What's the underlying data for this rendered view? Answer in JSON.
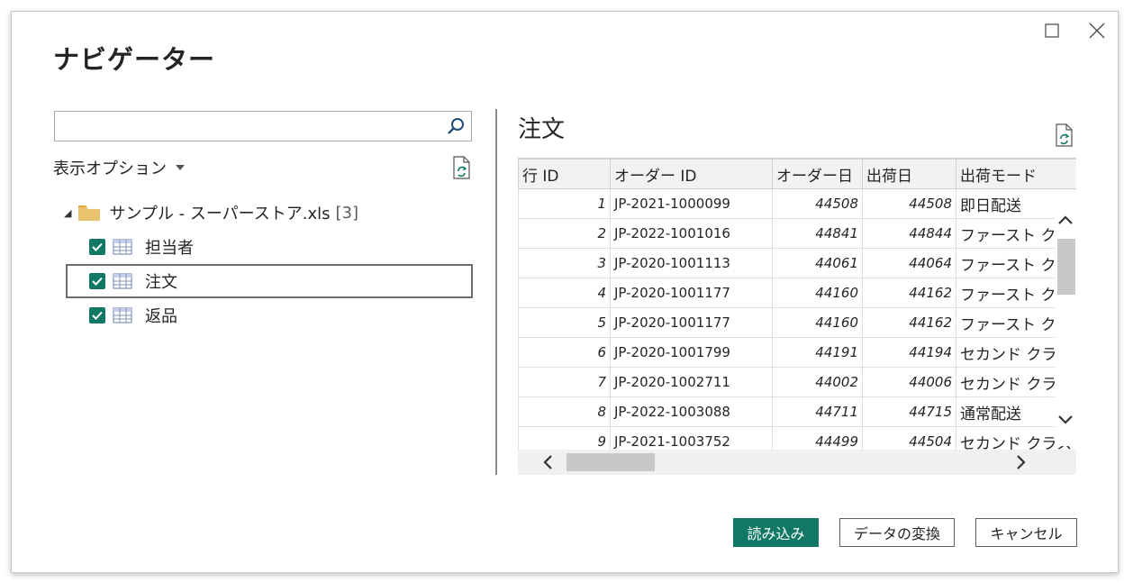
{
  "window": {
    "title": "ナビゲーター"
  },
  "search": {
    "placeholder": "",
    "value": ""
  },
  "view_options": {
    "label": "表示オプション"
  },
  "tree": {
    "file": {
      "name": "サンプル - スーパーストア.xls",
      "count": "[3]"
    },
    "items": [
      {
        "label": "担当者",
        "checked": true,
        "selected": false
      },
      {
        "label": "注文",
        "checked": true,
        "selected": true
      },
      {
        "label": "返品",
        "checked": true,
        "selected": false
      }
    ]
  },
  "preview": {
    "title": "注文",
    "columns": [
      "行 ID",
      "オーダー ID",
      "オーダー日",
      "出荷日",
      "出荷モード"
    ],
    "rows": [
      [
        "1",
        "JP-2021-1000099",
        "44508",
        "44508",
        "即日配送"
      ],
      [
        "2",
        "JP-2022-1001016",
        "44841",
        "44844",
        "ファースト クラ"
      ],
      [
        "3",
        "JP-2020-1001113",
        "44061",
        "44064",
        "ファースト クラ"
      ],
      [
        "4",
        "JP-2020-1001177",
        "44160",
        "44162",
        "ファースト クラ"
      ],
      [
        "5",
        "JP-2020-1001177",
        "44160",
        "44162",
        "ファースト クラ"
      ],
      [
        "6",
        "JP-2020-1001799",
        "44191",
        "44194",
        "セカンド クラス"
      ],
      [
        "7",
        "JP-2020-1002711",
        "44002",
        "44006",
        "セカンド クラス"
      ],
      [
        "8",
        "JP-2022-1003088",
        "44711",
        "44715",
        "通常配送"
      ],
      [
        "9",
        "JP-2021-1003752",
        "44499",
        "44504",
        "セカンド クラス"
      ]
    ]
  },
  "buttons": {
    "load": "読み込み",
    "transform": "データの変換",
    "cancel": "キャンセル"
  },
  "colors": {
    "accent": "#117865"
  }
}
